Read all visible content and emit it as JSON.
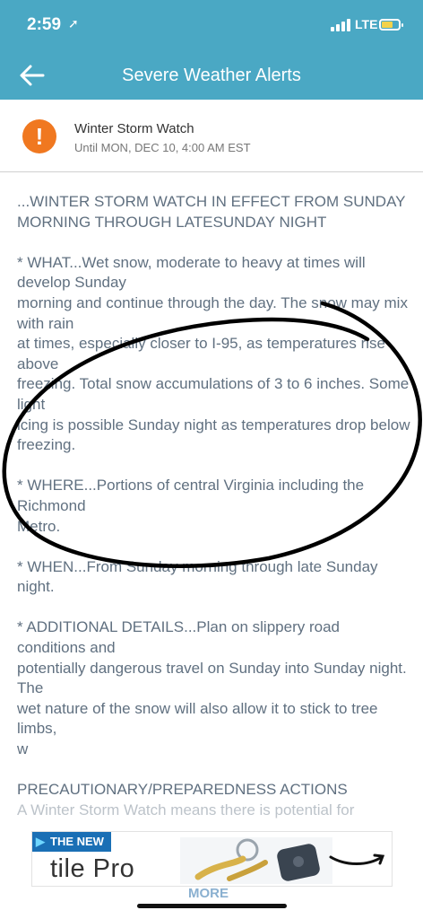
{
  "status_bar": {
    "time": "2:59",
    "network": "LTE"
  },
  "header": {
    "title": "Severe Weather Alerts"
  },
  "alert": {
    "title": "Winter Storm Watch",
    "until": "Until MON, DEC 10, 4:00 AM EST",
    "body": "...WINTER STORM WATCH IN EFFECT FROM SUNDAY MORNING THROUGH LATESUNDAY NIGHT\n\n* WHAT...Wet snow, moderate to heavy at times will develop Sunday\nmorning and continue through the day. The snow may mix with rain\nat times, especially closer to I-95, as temperatures rise above\nfreezing. Total snow accumulations of 3 to 6 inches. Some light\nicing is possible Sunday night as temperatures drop below\nfreezing.\n\n* WHERE...Portions of central Virginia including the Richmond\nMetro.\n\n* WHEN...From Sunday morning through late Sunday night.\n\n* ADDITIONAL DETAILS...Plan on slippery road conditions and\npotentially dangerous travel on Sunday into Sunday night. The\nwet nature of the snow will also allow it to stick to tree limbs,\nw\n\nPRECAUTIONARY/PREPAREDNESS ACTIONS\nA Winter Storm Watch means there is potential for"
  },
  "ad": {
    "badge": "THE NEW",
    "product": "tile Pro",
    "more": "MORE"
  },
  "colors": {
    "header_bg": "#4aa8c4",
    "alert_icon": "#f07820",
    "body_text": "#607080",
    "annotation": "#000000"
  },
  "icons": {
    "back": "arrow-left-icon",
    "alert": "exclamation-icon",
    "location": "location-arrow-icon",
    "battery": "battery-icon"
  }
}
